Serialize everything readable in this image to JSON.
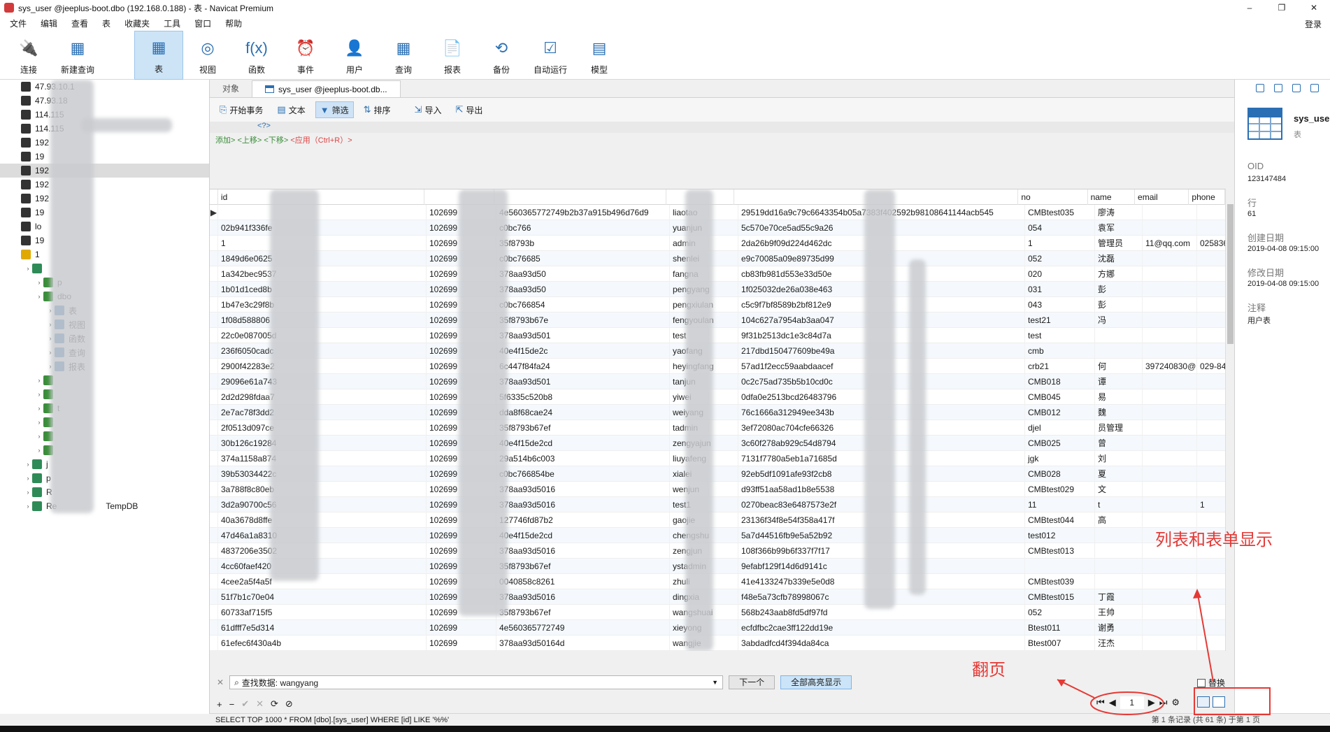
{
  "window": {
    "title": "sys_user @jeeplus-boot.dbo (192.168.0.188) - 表 - Navicat Premium",
    "controls": [
      "–",
      "❐",
      "✕"
    ]
  },
  "menu": {
    "items": [
      "文件",
      "编辑",
      "查看",
      "表",
      "收藏夹",
      "工具",
      "窗口",
      "帮助"
    ],
    "login": "登录"
  },
  "ribbon": {
    "buttons": [
      {
        "label": "连接",
        "icon": "plug-icon",
        "glyph": "🔌"
      },
      {
        "label": "新建查询",
        "icon": "new-query-icon",
        "glyph": "▦"
      },
      {
        "label": "表",
        "icon": "table-icon",
        "glyph": "▦",
        "active": true
      },
      {
        "label": "视图",
        "icon": "view-icon",
        "glyph": "◎"
      },
      {
        "label": "函数",
        "icon": "function-icon",
        "glyph": "f(x)"
      },
      {
        "label": "事件",
        "icon": "clock-icon",
        "glyph": "⏰"
      },
      {
        "label": "用户",
        "icon": "user-icon",
        "glyph": "👤"
      },
      {
        "label": "查询",
        "icon": "query-icon",
        "glyph": "▦"
      },
      {
        "label": "报表",
        "icon": "report-icon",
        "glyph": "📄"
      },
      {
        "label": "备份",
        "icon": "backup-icon",
        "glyph": "⟲"
      },
      {
        "label": "自动运行",
        "icon": "schedule-icon",
        "glyph": "☑"
      },
      {
        "label": "模型",
        "icon": "model-icon",
        "glyph": "▤"
      }
    ]
  },
  "nav": {
    "rows": [
      {
        "label": "47.93.10.1",
        "indent": 0,
        "icon": "server-icon"
      },
      {
        "label": "47.93.18",
        "indent": 0,
        "icon": "server-icon"
      },
      {
        "label": "114.115",
        "indent": 0,
        "icon": "server-icon"
      },
      {
        "label": "114.115",
        "indent": 0,
        "icon": "server-icon"
      },
      {
        "label": "192",
        "indent": 0,
        "icon": "server-icon"
      },
      {
        "label": "19",
        "indent": 0,
        "icon": "server-icon"
      },
      {
        "label": "192",
        "indent": 0,
        "icon": "server-icon",
        "selected": true
      },
      {
        "label": "192",
        "indent": 0,
        "icon": "server-icon"
      },
      {
        "label": "192",
        "indent": 0,
        "icon": "server-icon"
      },
      {
        "label": "19",
        "indent": 0,
        "icon": "server-icon"
      },
      {
        "label": "lo",
        "indent": 0,
        "icon": "server-icon"
      },
      {
        "label": "19",
        "indent": 0,
        "icon": "server-icon"
      },
      {
        "label": "1",
        "indent": 0,
        "icon": "server-open-icon"
      },
      {
        "label": "",
        "indent": 1,
        "icon": "database-icon"
      },
      {
        "label": "p",
        "indent": 2,
        "icon": "schema-icon"
      },
      {
        "label": "dbo",
        "indent": 2,
        "icon": "schema-icon"
      },
      {
        "label": "表",
        "indent": 3,
        "icon": "table-icon"
      },
      {
        "label": "视图",
        "indent": 3,
        "icon": "view-icon"
      },
      {
        "label": "函数",
        "indent": 3,
        "icon": "function-icon"
      },
      {
        "label": "查询",
        "indent": 3,
        "icon": "query-icon"
      },
      {
        "label": "报表",
        "indent": 3,
        "icon": "report-icon"
      },
      {
        "label": "",
        "indent": 2,
        "icon": "schema-icon"
      },
      {
        "label": "",
        "indent": 2,
        "icon": "schema-icon"
      },
      {
        "label": "t",
        "indent": 2,
        "icon": "schema-icon"
      },
      {
        "label": "",
        "indent": 2,
        "icon": "schema-icon"
      },
      {
        "label": "",
        "indent": 2,
        "icon": "schema-icon"
      },
      {
        "label": "",
        "indent": 2,
        "icon": "schema-icon"
      },
      {
        "label": "j",
        "indent": 1,
        "icon": "database-icon"
      },
      {
        "label": "p",
        "indent": 1,
        "icon": "database-icon"
      },
      {
        "label": "R",
        "indent": 1,
        "icon": "database-icon"
      },
      {
        "label": "Re",
        "indent": 1,
        "icon": "database-icon",
        "suffix": "TempDB"
      }
    ]
  },
  "tabs": {
    "objects": "对象",
    "active": "sys_user @jeeplus-boot.db..."
  },
  "subtoolbar": {
    "buttons": [
      {
        "label": "开始事务",
        "glyph": "⎘"
      },
      {
        "label": "文本",
        "glyph": "▤"
      },
      {
        "label": "筛选",
        "glyph": "▼",
        "active": true
      },
      {
        "label": "排序",
        "glyph": "⇅"
      },
      {
        "label": "导入",
        "glyph": "⇲"
      },
      {
        "label": "导出",
        "glyph": "⇱"
      }
    ]
  },
  "filter": {
    "line": "<?>",
    "hint_add": "添加>",
    "hint_up": "<上移>",
    "hint_down": "<下移>",
    "hint_apply": "<应用（Ctrl+R）>"
  },
  "grid": {
    "columns": [
      "id",
      "",
      "",
      "",
      "",
      "no",
      "name",
      "email",
      "phone"
    ],
    "rows": [
      [
        "",
        "102699",
        "4e560365772749b2b37a915b496d76d9",
        "liaotao",
        "29519dd16a9c79c6643354b05a7383f402592b98108641144acb545",
        "CMBtest035",
        "廖涛",
        "",
        ""
      ],
      [
        "02b941f336fe",
        "102699",
        "c0bc766",
        "yuanjun",
        "5c570e70ce5ad55c9a26",
        "054",
        "袁军",
        "",
        ""
      ],
      [
        "1",
        "102699",
        "35f8793b",
        "admin",
        "2da26b9f09d224d462dc",
        "1",
        "管理员",
        "11@qq.com",
        "02583655"
      ],
      [
        "1849d6e0625",
        "102699",
        "c0bc76685",
        "shenlei",
        "e9c70085a09e89735d99",
        "052",
        "沈磊",
        "",
        ""
      ],
      [
        "1a342bec9537",
        "102699",
        "378aa93d50",
        "fangna",
        "cb83fb981d553e33d50e",
        "020",
        "方娜",
        "",
        ""
      ],
      [
        "1b01d1ced8b",
        "102699",
        "378aa93d50",
        "pengyang",
        "1f025032de26a038e463",
        "031",
        "彭",
        "",
        ""
      ],
      [
        "1b47e3c29f8b",
        "102699",
        "c0bc766854",
        "pengxiulan",
        "c5c9f7bf8589b2bf812e9",
        "043",
        "彭",
        "",
        ""
      ],
      [
        "1f08d588806",
        "102699",
        "35f8793b67e",
        "fengyoulan",
        "104c627a7954ab3aa047",
        "test21",
        "冯",
        "",
        ""
      ],
      [
        "22c0e087005d",
        "102699",
        "378aa93d501",
        "test",
        "9f31b2513dc1e3c84d7a",
        "test",
        "",
        "",
        ""
      ],
      [
        "236f6050cadc",
        "102699",
        "40e4f15de2c",
        "yaofang",
        "217dbd150477609be49a",
        "cmb",
        "",
        "",
        ""
      ],
      [
        "2900f42283e2",
        "102699",
        "6c447f84fa24",
        "heyingfang",
        "57ad1f2ecc59aabdaacef",
        "crb21",
        "何",
        "397240830@",
        "029-8450"
      ],
      [
        "29096e61a743",
        "102699",
        "378aa93d501",
        "tanjun",
        "0c2c75ad735b5b10cd0c",
        "CMB018",
        "谭",
        "",
        ""
      ],
      [
        "2d2d298fdaa7",
        "102699",
        "5f6335c520b8",
        "yiwei",
        "0dfa0e2513bcd26483796",
        "CMB045",
        "易",
        "",
        ""
      ],
      [
        "2e7ac78f3dd2",
        "102699",
        "dda8f68cae24",
        "weiyang",
        "76c1666a312949ee343b",
        "CMB012",
        "魏",
        "",
        ""
      ],
      [
        "2f0513d097ce",
        "102699",
        "35f8793b67ef",
        "tadmin",
        "3ef72080ac704cfe66326",
        "djel",
        "员管理",
        "",
        ""
      ],
      [
        "30b126c19284",
        "102699",
        "40e4f15de2cd",
        "zengyajun",
        "3c60f278ab929c54d8794",
        "CMB025",
        "曾",
        "",
        ""
      ],
      [
        "374a1158a874",
        "102699",
        "29a514b6c003",
        "liuyafeng",
        "7131f7780a5eb1a71685d",
        "jgk",
        "刘",
        "",
        ""
      ],
      [
        "39b53034422c",
        "102699",
        "c0bc766854be",
        "xialei",
        "92eb5df1091afe93f2cb8",
        "CMB028",
        "夏",
        "",
        ""
      ],
      [
        "3a788f8c80eb",
        "102699",
        "378aa93d5016",
        "wenjun",
        "d93ff51aa58ad1b8e5538",
        "CMBtest029",
        "文",
        "",
        ""
      ],
      [
        "3d2a90700c56",
        "102699",
        "378aa93d5016",
        "test1",
        "0270beac83e6487573e2f",
        "11",
        "t",
        "",
        "1"
      ],
      [
        "40a3678d8ffe",
        "102699",
        "127746fd87b2",
        "gaojie",
        "23136f34f8e54f358a417f",
        "CMBtest044",
        "高",
        "",
        ""
      ],
      [
        "47d46a1a8310",
        "102699",
        "40e4f15de2cd",
        "chengshu",
        "5a7d44516fb9e5a52b92",
        "test012",
        "",
        "",
        ""
      ],
      [
        "4837206e3502",
        "102699",
        "378aa93d5016",
        "zengjun",
        "108f366b99b6f337f7f17",
        "CMBtest013",
        "",
        "",
        ""
      ],
      [
        "4cc60faef420",
        "102699",
        "35f8793b67ef",
        "ystadmin",
        "9efabf129f14d6d9141c",
        "",
        "",
        "",
        ""
      ],
      [
        "4cee2a5f4a5f",
        "102699",
        "0040858c8261",
        "zhuli",
        "41e4133247b339e5e0d8",
        "CMBtest039",
        "",
        "",
        ""
      ],
      [
        "51f7b1c70e04",
        "102699",
        "378aa93d5016",
        "dingxia",
        "f48e5a73cfb78998067c",
        "CMBtest015",
        "丁霞",
        "",
        ""
      ],
      [
        "60733af715f5",
        "102699",
        "35f8793b67ef",
        "wangshuai",
        "568b243aab8fd5df97fd",
        "052",
        "王帅",
        "",
        ""
      ],
      [
        "61dfff7e5d314",
        "102699",
        "4e560365772749",
        "xieyong",
        "ecfdfbc2cae3ff122dd19e",
        "Btest011",
        "谢勇",
        "",
        ""
      ],
      [
        "61efec6f430a4b",
        "102699",
        "378aa93d50164d",
        "wangjie",
        "3abdadfcd4f394da84ca",
        "Btest007",
        "汪杰",
        "",
        ""
      ]
    ]
  },
  "search": {
    "label": "查找数据: wangyang",
    "next_btn": "下一个",
    "highlight_btn": "全部高亮显示",
    "replace_label": "替换"
  },
  "recbar": {
    "buttons": [
      "+",
      "−",
      "✔",
      "✕",
      "⟳",
      "⊘"
    ]
  },
  "pager": {
    "page": "1",
    "first": "⏮",
    "prev": "◀",
    "next": "▶",
    "last": "⏭",
    "settings": "⚙"
  },
  "status": {
    "sql": "SELECT TOP 1000 * FROM [dbo].[sys_user] WHERE [id] LIKE '%%'",
    "records": "第 1 条记录 (共 61 条) 于第 1 页"
  },
  "info": {
    "name": "sys_use",
    "type": "表",
    "oid_label": "OID",
    "oid": "123147484",
    "rows_label": "行",
    "rows": "61",
    "created_label": "创建日期",
    "created": "2019-04-08 09:15:00",
    "modified_label": "修改日期",
    "modified": "2019-04-08 09:15:00",
    "comment_label": "注释",
    "comment": "用户表"
  },
  "annotations": {
    "list_form": "列表和表单显示",
    "paging": "翻页"
  },
  "colors": {
    "accent": "#2a6fb3",
    "annotation": "#e53935",
    "selected_row": "#dcdcdc"
  }
}
